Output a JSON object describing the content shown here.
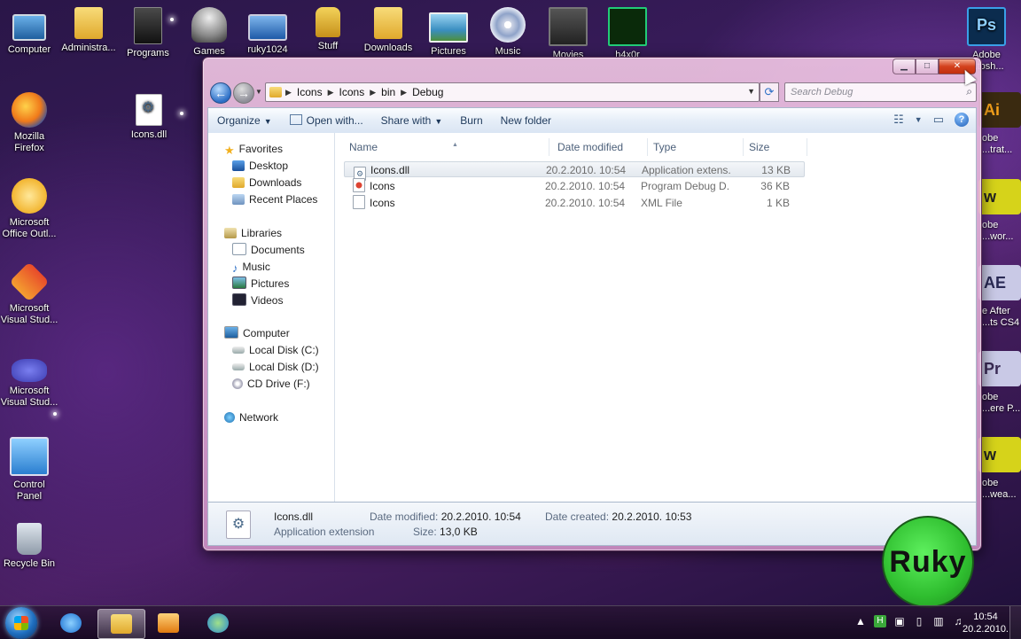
{
  "desktop": {
    "top_icons": [
      {
        "label": "Computer",
        "icon": "computer-icon"
      },
      {
        "label": "Administra...",
        "icon": "user-folder-icon"
      },
      {
        "label": "Programs",
        "icon": "programs-icon"
      },
      {
        "label": "Games",
        "icon": "games-icon"
      },
      {
        "label": "ruky1024",
        "icon": "laptop-icon"
      },
      {
        "label": "Stuff",
        "icon": "lock-icon"
      },
      {
        "label": "Downloads",
        "icon": "folder-icon"
      },
      {
        "label": "Pictures",
        "icon": "pictures-icon"
      },
      {
        "label": "Music",
        "icon": "cd-icon"
      },
      {
        "label": "Movies",
        "icon": "movies-icon"
      },
      {
        "label": "h4x0r",
        "icon": "monitor-icon"
      }
    ],
    "ps_label": [
      "Adobe",
      "...tosh..."
    ],
    "left_icons": [
      {
        "label": [
          "Mozilla",
          "Firefox"
        ],
        "icon": "firefox-icon"
      },
      {
        "label": [
          "Microsoft",
          "Office Outl..."
        ],
        "icon": "outlook-icon"
      },
      {
        "label": [
          "Microsoft",
          "Visual Stud..."
        ],
        "icon": "visual-studio-icon"
      },
      {
        "label": [
          "Microsoft",
          "Visual Stud..."
        ],
        "icon": "visual-studio-2-icon"
      },
      {
        "label": [
          "Control",
          "Panel"
        ],
        "icon": "control-panel-icon"
      },
      {
        "label": [
          "Recycle Bin"
        ],
        "icon": "recycle-bin-icon"
      }
    ],
    "icons_dll_label": "Icons.dll",
    "right_partial": [
      {
        "glyph": "Ai",
        "label": [
          "obe",
          "...trat..."
        ],
        "color": "#f7a21b"
      },
      {
        "glyph": "w",
        "label": [
          "obe",
          "...wor..."
        ],
        "color": "#d6d31a"
      },
      {
        "glyph": "AE",
        "label": [
          "e After",
          "...ts CS4"
        ],
        "color": "#c9c9e6"
      },
      {
        "glyph": "Pr",
        "label": [
          "obe",
          "...ere P..."
        ],
        "color": "#c9c9e6"
      },
      {
        "glyph": "w",
        "label": [
          "obe",
          "...wea..."
        ],
        "color": "#d6d31a"
      }
    ],
    "watermark": "Ruky"
  },
  "window": {
    "address": {
      "crumbs": [
        "Icons",
        "Icons",
        "bin",
        "Debug"
      ]
    },
    "search": {
      "placeholder": "Search Debug"
    },
    "toolbar": {
      "organize": "Organize",
      "open_with": "Open with...",
      "share_with": "Share with",
      "burn": "Burn",
      "new_folder": "New folder"
    },
    "nav": {
      "favorites": "Favorites",
      "desktop": "Desktop",
      "downloads": "Downloads",
      "recent": "Recent Places",
      "libraries": "Libraries",
      "documents": "Documents",
      "music": "Music",
      "pictures": "Pictures",
      "videos": "Videos",
      "computer": "Computer",
      "disk_c": "Local Disk (C:)",
      "disk_d": "Local Disk (D:)",
      "cd": "CD Drive (F:)",
      "network": "Network"
    },
    "columns": {
      "name": "Name",
      "date": "Date modified",
      "type": "Type",
      "size": "Size"
    },
    "files": [
      {
        "name": "Icons.dll",
        "date": "20.2.2010. 10:54",
        "type": "Application extens...",
        "size": "13 KB"
      },
      {
        "name": "Icons",
        "date": "20.2.2010. 10:54",
        "type": "Program Debug D...",
        "size": "36 KB"
      },
      {
        "name": "Icons",
        "date": "20.2.2010. 10:54",
        "type": "XML File",
        "size": "1 KB"
      }
    ],
    "details": {
      "name": "Icons.dll",
      "kind": "Application extension",
      "date_modified_label": "Date modified:",
      "date_modified": "20.2.2010. 10:54",
      "size_label": "Size:",
      "size": "13,0 KB",
      "date_created_label": "Date created:",
      "date_created": "20.2.2010. 10:53"
    }
  },
  "taskbar": {
    "time": "10:54",
    "date": "20.2.2010."
  }
}
